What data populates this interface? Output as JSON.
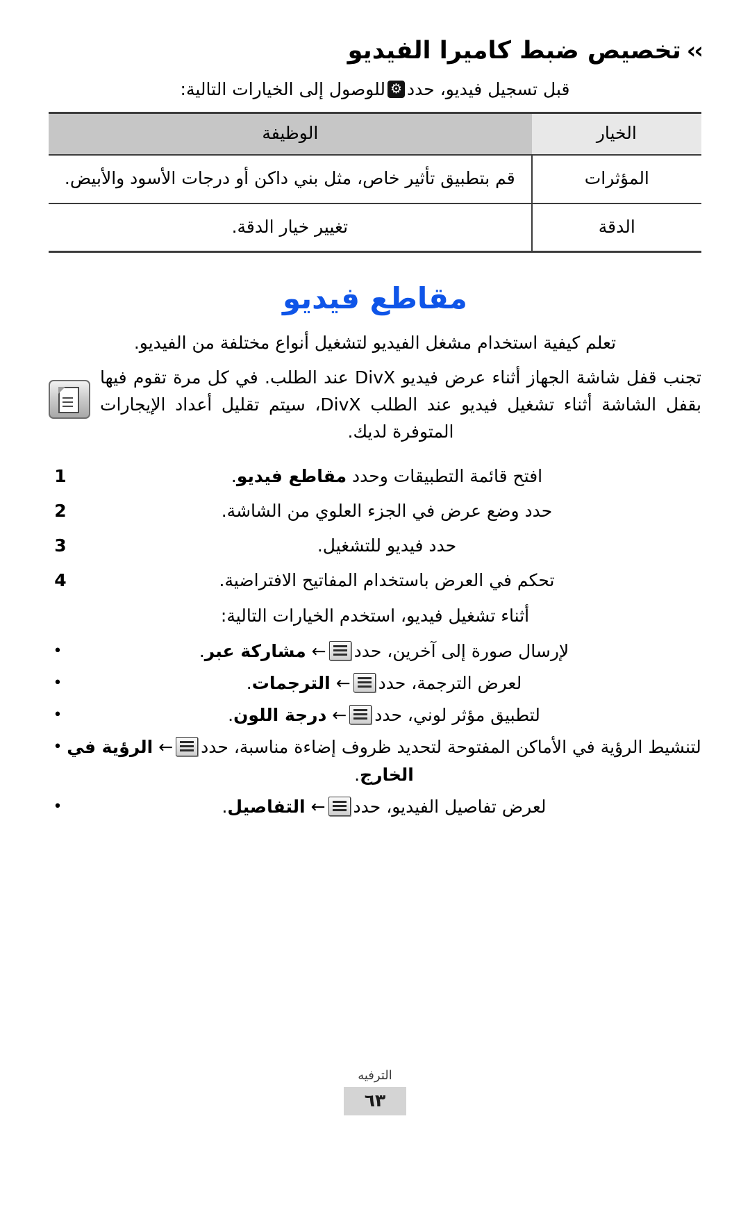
{
  "section": {
    "chevrons": "››",
    "title": "تخصيص ضبط كاميرا الفيديو",
    "intro_before_icon": "قبل تسجيل فيديو، حدد",
    "intro_after_icon": "للوصول إلى الخيارات التالية:"
  },
  "table": {
    "headers": {
      "option": "الخيار",
      "function": "الوظيفة"
    },
    "rows": [
      {
        "option": "المؤثرات",
        "function": "قم بتطبيق تأثير خاص، مثل بني داكن أو درجات الأسود والأبيض."
      },
      {
        "option": "الدقة",
        "function": "تغيير خيار الدقة."
      }
    ]
  },
  "chapter": {
    "heading": "مقاطع فيديو",
    "intro": "تعلم كيفية استخدام مشغل الفيديو لتشغيل أنواع مختلفة من الفيديو."
  },
  "note": {
    "icon": "note-icon",
    "text": "تجنب قفل شاشة الجهاز أثناء عرض فيديو DivX عند الطلب. في كل مرة تقوم فيها بقفل الشاشة أثناء تشغيل فيديو عند الطلب DivX، سيتم تقليل أعداد الإيجارات المتوفرة لديك."
  },
  "steps": [
    {
      "num": "1",
      "parts": [
        {
          "text": "افتح قائمة التطبيقات وحدد ",
          "bold": false
        },
        {
          "text": "مقاطع فيديو",
          "bold": true
        },
        {
          "text": ".",
          "bold": false
        }
      ]
    },
    {
      "num": "2",
      "parts": [
        {
          "text": "حدد وضع عرض في الجزء العلوي من الشاشة.",
          "bold": false
        }
      ]
    },
    {
      "num": "3",
      "parts": [
        {
          "text": "حدد فيديو للتشغيل.",
          "bold": false
        }
      ]
    },
    {
      "num": "4",
      "parts": [
        {
          "text": "تحكم في العرض باستخدام المفاتيح الافتراضية.",
          "bold": false
        }
      ]
    }
  ],
  "bullets_intro": "أثناء تشغيل فيديو، استخدم الخيارات التالية:",
  "bullets": [
    {
      "marker": "•",
      "before": "لإرسال صورة إلى آخرين، حدد",
      "arrow": "←",
      "bold_label": "مشاركة عبر",
      "after": "."
    },
    {
      "marker": "•",
      "before": "لعرض الترجمة، حدد",
      "arrow": "←",
      "bold_label": "الترجمات",
      "after": "."
    },
    {
      "marker": "•",
      "before": "لتطبيق مؤثر لوني، حدد",
      "arrow": "←",
      "bold_label": "درجة اللون",
      "after": "."
    },
    {
      "marker": "•",
      "before": "لتنشيط الرؤية في الأماكن المفتوحة لتحديد ظروف إضاءة مناسبة، حدد",
      "arrow": "←",
      "bold_label": "الرؤية في الخارج",
      "after": "."
    },
    {
      "marker": "•",
      "before": "لعرض تفاصيل الفيديو، حدد",
      "arrow": "←",
      "bold_label": "التفاصيل",
      "after": "."
    }
  ],
  "footer": {
    "chapter": "الترفيه",
    "page_number": "٦٣"
  },
  "colors": {
    "heading_blue": "#0f55e8",
    "table_header_option_bg": "#e8e8e8",
    "table_header_function_bg": "#c6c6c6",
    "table_border": "#3c3c3c",
    "footer_page_bg": "#d4d4d4"
  }
}
